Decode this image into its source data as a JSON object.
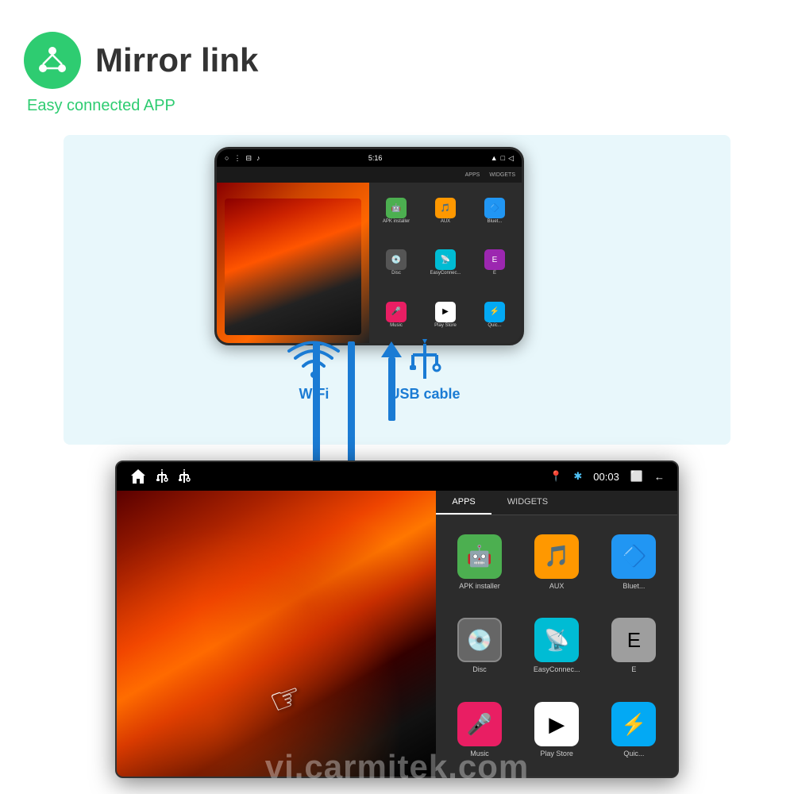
{
  "header": {
    "title": "Mirror link",
    "subtitle": "Easy connected APP",
    "icon_name": "mirror-link-icon"
  },
  "connection": {
    "wifi_label": "WiFi",
    "usb_label": "USB cable"
  },
  "phone": {
    "time": "5:16",
    "tabs": [
      "APPS",
      "WIDGETS"
    ],
    "apps": [
      {
        "label": "APK installer",
        "color": "#4CAF50",
        "icon": "🤖"
      },
      {
        "label": "AUX",
        "color": "#FF9800",
        "icon": "🎵"
      },
      {
        "label": "Bluet...",
        "color": "#2196F3",
        "icon": "🔷"
      },
      {
        "label": "Disc",
        "color": "#555",
        "icon": "💿"
      },
      {
        "label": "EasyConnec...",
        "color": "#00BCD4",
        "icon": "📡"
      },
      {
        "label": "E",
        "color": "#9C27B0",
        "icon": "E"
      },
      {
        "label": "Music",
        "color": "#E91E63",
        "icon": "🎤"
      },
      {
        "label": "Play Store",
        "color": "#fff",
        "icon": "▶"
      },
      {
        "label": "Quic...",
        "color": "#03A9F4",
        "icon": "⚡"
      }
    ]
  },
  "car_display": {
    "status_left": [
      "🏠",
      "⚡",
      "⚡"
    ],
    "status_right": [
      "📍",
      "🔵",
      "00:03",
      "⬜",
      "←"
    ],
    "tabs": [
      "APPS",
      "WIDGETS"
    ],
    "apps": [
      {
        "label": "APK installer",
        "color": "#4CAF50",
        "icon": "🤖"
      },
      {
        "label": "AUX",
        "color": "#FF9800",
        "icon": "🎵"
      },
      {
        "label": "Bluet...",
        "color": "#2196F3",
        "icon": "🔷"
      },
      {
        "label": "Disc",
        "color": "#555",
        "icon": "💿"
      },
      {
        "label": "EasyConnec...",
        "color": "#00BCD4",
        "icon": "📡"
      },
      {
        "label": "E",
        "color": "#9C27B0",
        "icon": "E"
      },
      {
        "label": "Music",
        "color": "#E91E63",
        "icon": "🎤"
      },
      {
        "label": "Play Store",
        "color": "#fff",
        "icon": "▶"
      },
      {
        "label": "Quic...",
        "color": "#03A9F4",
        "icon": "⚡"
      }
    ]
  },
  "watermark": {
    "text": "vi.carmitek.com"
  }
}
